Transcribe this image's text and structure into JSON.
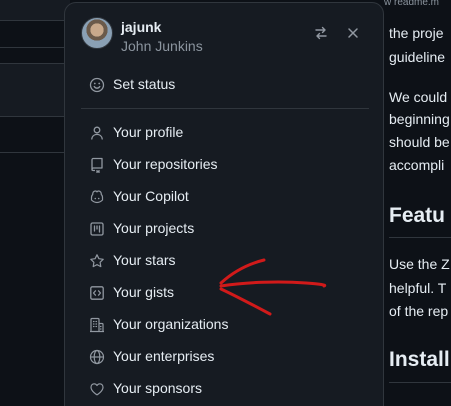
{
  "background_right": {
    "tab_fragment": "w readme.m",
    "lines": [
      "the proje",
      "guideline",
      "We could",
      "beginning",
      "should be",
      "accompli"
    ],
    "heading_features": "Featu",
    "lines2": [
      "Use the Z",
      "helpful. T",
      "of the rep"
    ],
    "heading_install": "Install"
  },
  "menu": {
    "username": "jajunk",
    "fullname": "John Junkins",
    "status_item": {
      "label": "Set status",
      "icon": "smiley-icon"
    },
    "items": [
      {
        "label": "Your profile",
        "icon": "person-icon"
      },
      {
        "label": "Your repositories",
        "icon": "repo-icon"
      },
      {
        "label": "Your Copilot",
        "icon": "copilot-icon"
      },
      {
        "label": "Your projects",
        "icon": "project-icon"
      },
      {
        "label": "Your stars",
        "icon": "star-icon"
      },
      {
        "label": "Your gists",
        "icon": "code-square-icon"
      },
      {
        "label": "Your organizations",
        "icon": "organization-icon"
      },
      {
        "label": "Your enterprises",
        "icon": "globe-icon"
      },
      {
        "label": "Your sponsors",
        "icon": "heart-icon"
      }
    ]
  },
  "colors": {
    "background": "#0d1117",
    "panel": "#161b22",
    "border": "#30363d",
    "text": "#e6edf3",
    "muted": "#8b949e",
    "annotation_arrow": "#d11a1a"
  }
}
